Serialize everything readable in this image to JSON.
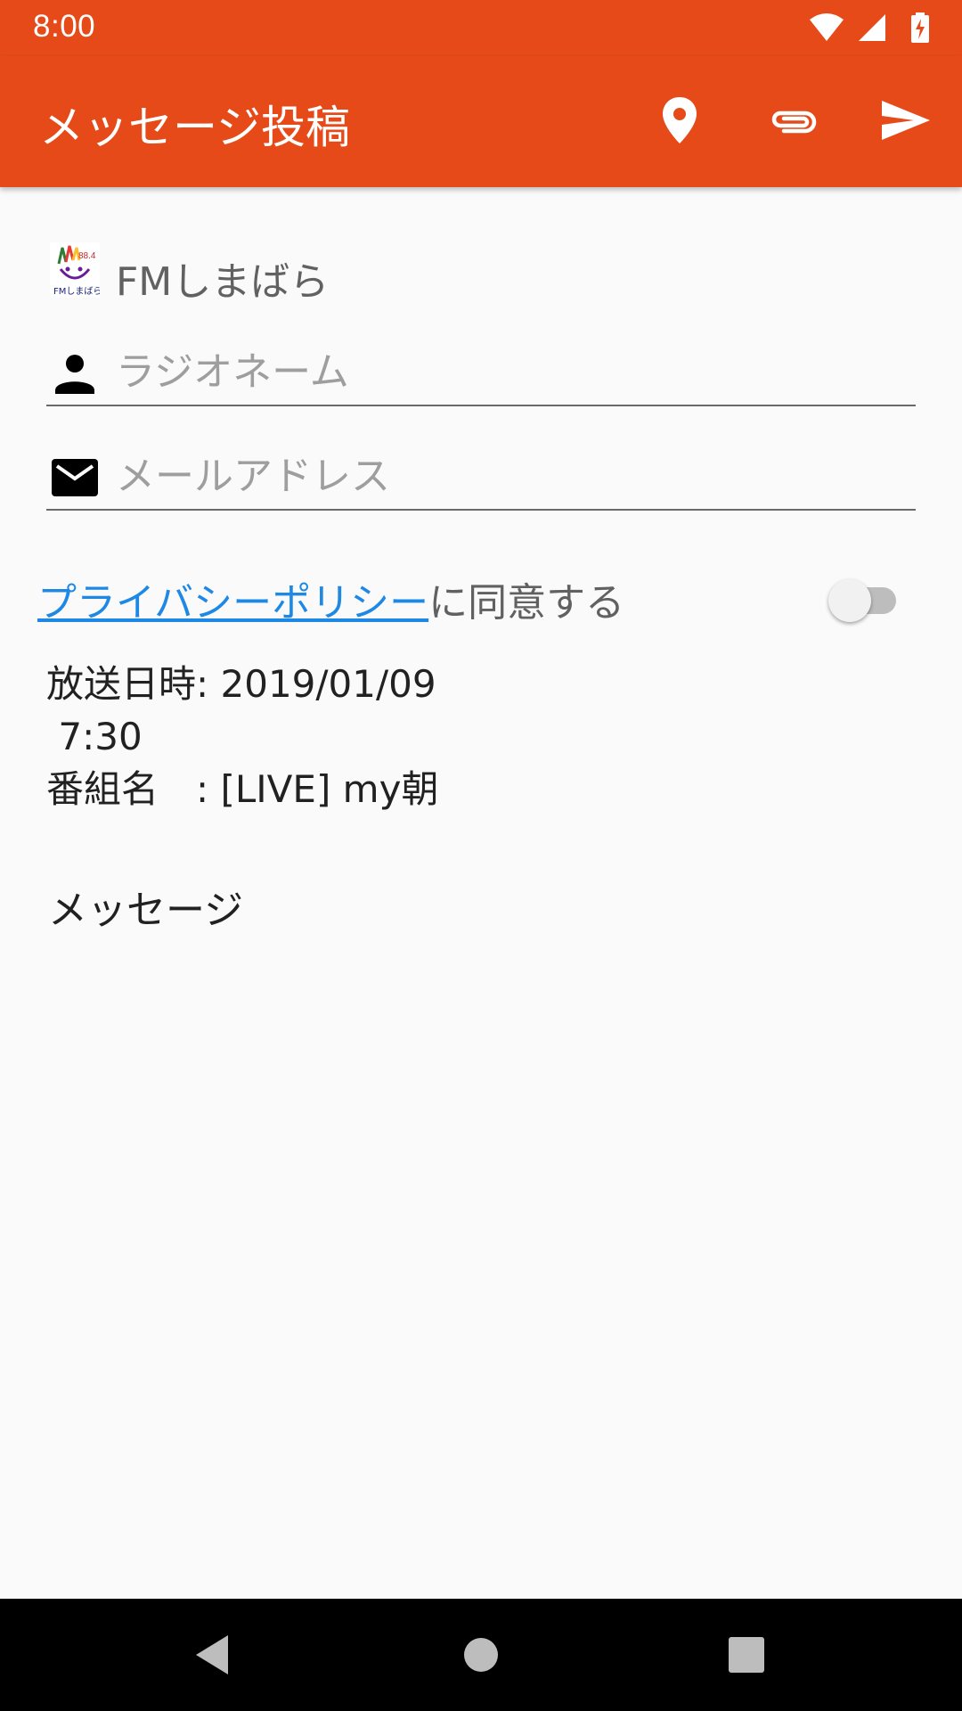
{
  "status_bar": {
    "time": "8:00",
    "icons": [
      "wifi-icon",
      "signal-icon",
      "battery-charging-icon"
    ]
  },
  "app_bar": {
    "title": "メッセージ投稿",
    "actions": [
      "location-icon",
      "attach-icon",
      "send-icon"
    ],
    "background_color": "#e64a19"
  },
  "station": {
    "name": "FMしまばら",
    "logo_text": "88.4 FMしまばら"
  },
  "form": {
    "radio_name_placeholder": "ラジオネーム",
    "email_placeholder": "メールアドレス",
    "privacy_link": "プライバシーポリシー",
    "privacy_suffix": "に同意する",
    "privacy_agreed": false
  },
  "broadcast": {
    "date_line": "放送日時: 2019/01/09",
    "time_line": " 7:30",
    "program_line": "番組名　: [LIVE] my朝"
  },
  "message_label": "メッセージ",
  "nav_bar": {
    "buttons": [
      "back-icon",
      "home-icon",
      "recents-icon"
    ]
  },
  "colors": {
    "accent": "#e64a19",
    "link": "#1e88e5"
  }
}
